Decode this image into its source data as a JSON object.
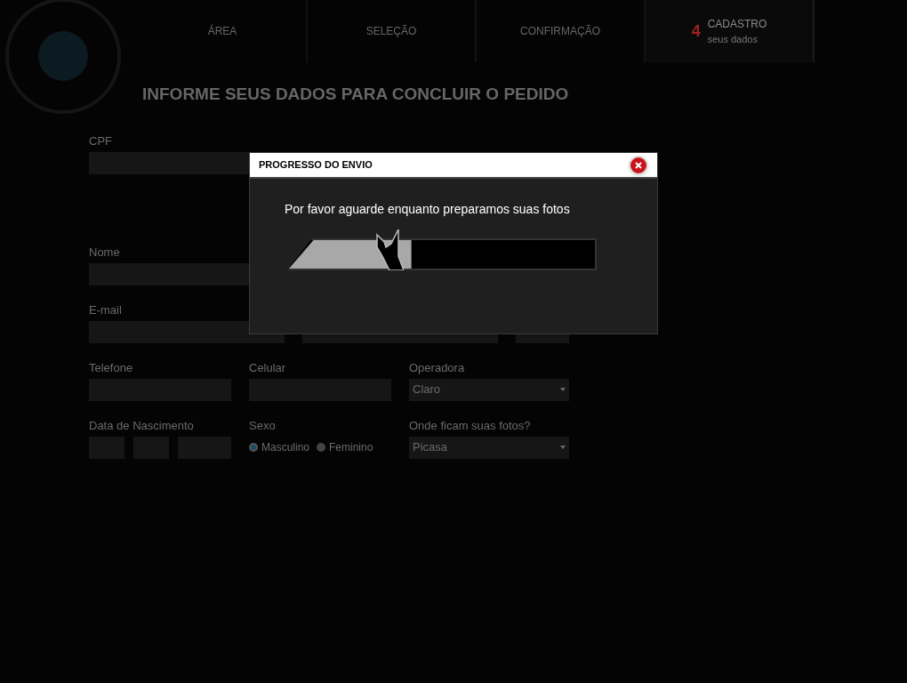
{
  "header": {
    "steps": [
      {
        "label": "ÁREA",
        "active": false
      },
      {
        "label": "SELEÇÃO",
        "active": false
      },
      {
        "label": "CONFIRMAÇÃO",
        "active": false
      },
      {
        "label": "CADASTRO",
        "sub": "seus dados",
        "number": "4",
        "active": true
      }
    ]
  },
  "title": "INFORME SEUS DADOS PARA CONCLUIR O PEDIDO",
  "form": {
    "cpf": {
      "label": "CPF"
    },
    "nome": {
      "label": "Nome"
    },
    "email": {
      "label": "E-mail"
    },
    "telefone": {
      "label": "Telefone"
    },
    "celular": {
      "label": "Celular"
    },
    "operadora": {
      "label": "Operadora",
      "value": "Claro"
    },
    "nascimento": {
      "label": "Data de Nascimento"
    },
    "sexo": {
      "label": "Sexo",
      "options": [
        {
          "label": "Masculino",
          "selected": true
        },
        {
          "label": "Feminino",
          "selected": false
        }
      ]
    },
    "fotos": {
      "label": "Onde ficam suas fotos?",
      "value": "Picasa"
    }
  },
  "dialog": {
    "title": "PROGRESSO DO ENVIO",
    "message": "Por favor aguarde enquanto preparamos suas fotos",
    "progress": {
      "level": 0.4
    }
  }
}
